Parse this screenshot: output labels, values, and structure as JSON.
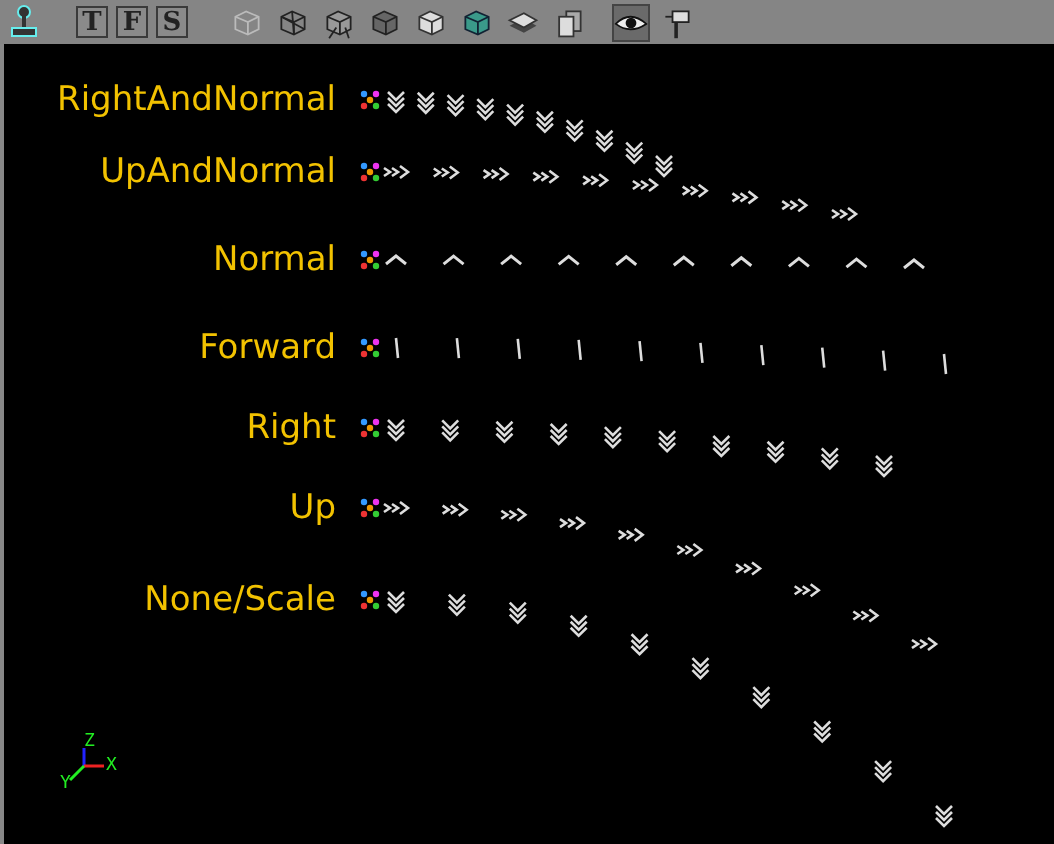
{
  "toolbar": {
    "mode_buttons": [
      {
        "label": "T",
        "selected": false
      },
      {
        "label": "F",
        "selected": false
      },
      {
        "label": "S",
        "selected": false
      }
    ],
    "shading_buttons": [
      {
        "kind": "wire-faint"
      },
      {
        "kind": "wire"
      },
      {
        "kind": "wire-lit"
      },
      {
        "kind": "shaded"
      },
      {
        "kind": "smooth"
      },
      {
        "kind": "textured"
      },
      {
        "kind": "layers"
      },
      {
        "kind": "stacked"
      }
    ],
    "view_toggles": [
      {
        "kind": "eye",
        "selected": true
      },
      {
        "kind": "pin",
        "selected": false
      }
    ]
  },
  "viewport": {
    "emitters": [
      {
        "label": "RightAndNormal",
        "kind": "down"
      },
      {
        "label": "UpAndNormal",
        "kind": "right"
      },
      {
        "label": "Normal",
        "kind": "up"
      },
      {
        "label": "Forward",
        "kind": "line"
      },
      {
        "label": "Right",
        "kind": "down"
      },
      {
        "label": "Up",
        "kind": "right"
      },
      {
        "label": "None/Scale",
        "kind": "down"
      }
    ],
    "axes": {
      "z": "Z",
      "y": "Y",
      "x": "X"
    }
  }
}
